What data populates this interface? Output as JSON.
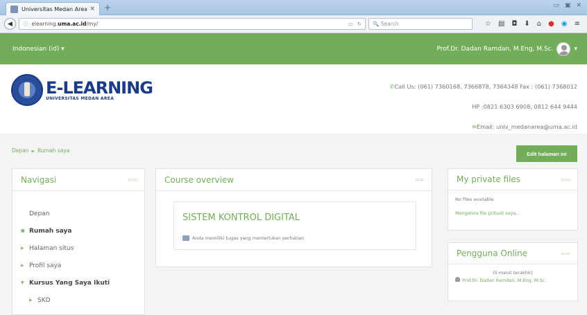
{
  "browser": {
    "tab_title": "Universitas Medan Area: R...",
    "tab_close": "×",
    "new_tab": "+",
    "window_controls": [
      "▭",
      "▣",
      "✕"
    ],
    "url_prefix": "elearning.",
    "url_host": "uma.ac.id",
    "url_path": "/my/",
    "search_placeholder": "Search"
  },
  "topbar": {
    "language": "Indonesian (id) ▾",
    "user_name": "Prof.Dr. Dadan Ramdan, M.Eng, M.Sc.",
    "user_menu_caret": "▾"
  },
  "logo": {
    "title": "E-LEARNING",
    "subtitle": "UNIVERSITAS MEDAN AREA"
  },
  "contact": {
    "phone": "Call Us: (061) 7360168, 7366878, 7364348 Fax : (061) 7368012",
    "hp": "HP :0821 6303 6908, 0812 644 9444",
    "email": "Email: univ_medanarea@uma.ac.id"
  },
  "breadcrumb": {
    "home": "Depan",
    "separator": "►",
    "current": "Rumah saya"
  },
  "edit_button": "Edit halaman ini",
  "navigation": {
    "title": "Navigasi",
    "controls": "▭▭",
    "items": [
      {
        "label": "Depan",
        "marker": ""
      },
      {
        "label": "Rumah saya",
        "marker": "■"
      },
      {
        "label": "Halaman situs",
        "marker": "▶"
      },
      {
        "label": "Profil saya",
        "marker": "▶"
      },
      {
        "label": "Kursus Yang Saya Ikuti",
        "marker": "▼"
      },
      {
        "label": "SKD",
        "marker": "▶"
      }
    ]
  },
  "course_overview": {
    "title": "Course overview",
    "controls": "▭▭",
    "course_name": "SISTEM KONTROL DIGITAL",
    "notice": "Anda memiliki tugas yang memerlukan perhatian"
  },
  "private_files": {
    "title": "My private files",
    "controls": "▭▭",
    "empty": "No files available",
    "manage_link": "Mengelola file pribadi saya..."
  },
  "online_users": {
    "title": "Pengguna Online",
    "controls": "▭▭",
    "period": "(5 menit terakhir)",
    "user": "Prof.Dr. Dadan Ramdan, M.Eng, M.Sc."
  }
}
